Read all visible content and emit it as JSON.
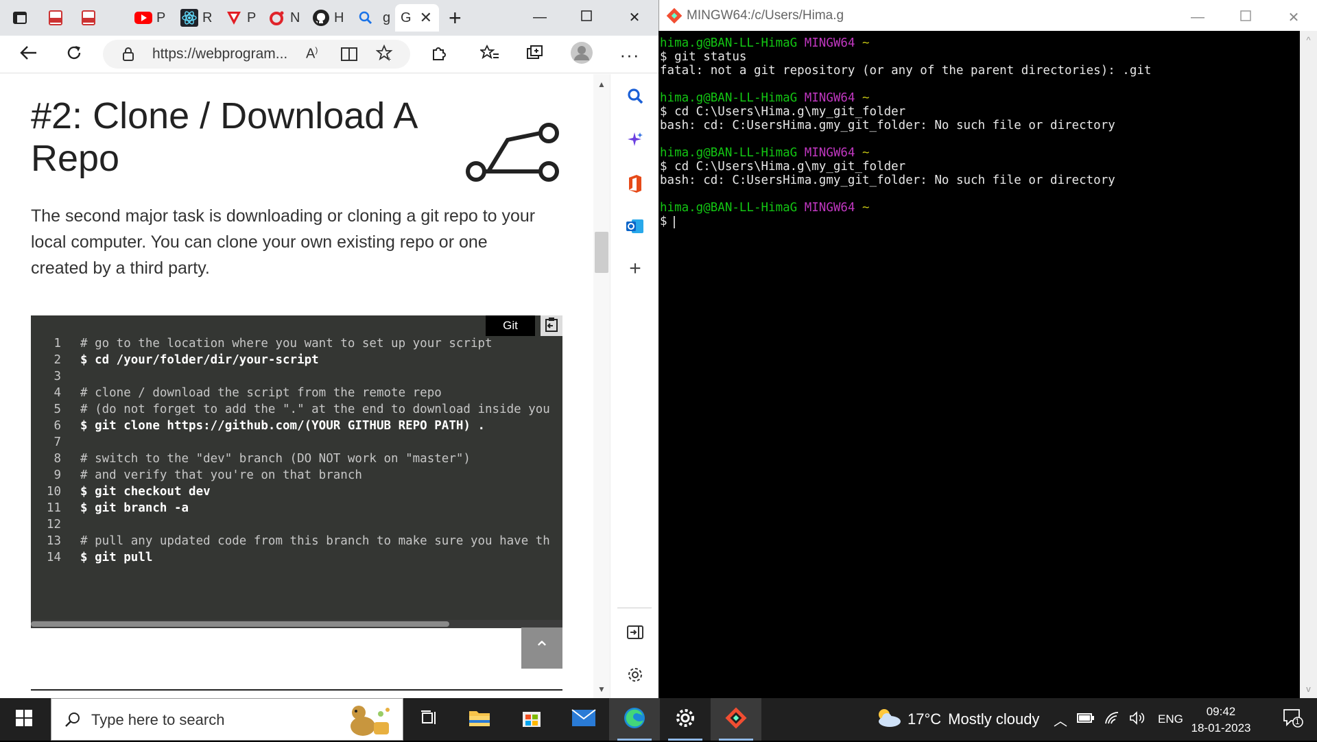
{
  "browser": {
    "tabs": [
      {
        "icon": "edge-tab-actions-icon",
        "label": ""
      },
      {
        "icon": "pdf-icon",
        "label": ""
      },
      {
        "icon": "pdf-icon",
        "label": ""
      },
      {
        "icon": "youtube-icon",
        "label": "P"
      },
      {
        "icon": "react-icon",
        "label": "R"
      },
      {
        "icon": "vivaldi-icon",
        "label": "P"
      },
      {
        "icon": "opera-icon",
        "label": "N"
      },
      {
        "icon": "github-icon",
        "label": "H"
      },
      {
        "icon": "search-icon",
        "label": "g"
      },
      {
        "icon": "g-icon",
        "label": "G"
      }
    ],
    "url": "https://webprogram...",
    "page": {
      "title": "#2: Clone / Download A Repo",
      "intro": "The second major task is downloading or cloning a git repo to your local computer. You can clone your own existing repo or one created by a third party.",
      "code_lang": "Git",
      "code_lines": [
        {
          "n": "1",
          "text": "# go to the location where you want to set up your script",
          "kind": "comment"
        },
        {
          "n": "2",
          "text": "$ cd /your/folder/dir/your-script",
          "kind": "cmd"
        },
        {
          "n": "3",
          "text": "",
          "kind": "comment"
        },
        {
          "n": "4",
          "text": "# clone / download the script from the remote repo",
          "kind": "comment"
        },
        {
          "n": "5",
          "text": "# (do not forget to add the \".\" at the end to download inside you",
          "kind": "comment"
        },
        {
          "n": "6",
          "text": "$ git clone https://github.com/(YOUR GITHUB REPO PATH) .",
          "kind": "cmd"
        },
        {
          "n": "7",
          "text": "",
          "kind": "comment"
        },
        {
          "n": "8",
          "text": "# switch to the \"dev\" branch (DO NOT work on \"master\")",
          "kind": "comment"
        },
        {
          "n": "9",
          "text": "# and verify that you're on that branch",
          "kind": "comment"
        },
        {
          "n": "10",
          "text": "$ git checkout dev",
          "kind": "cmd"
        },
        {
          "n": "11",
          "text": "$ git branch -a",
          "kind": "cmd"
        },
        {
          "n": "12",
          "text": "",
          "kind": "comment"
        },
        {
          "n": "13",
          "text": "# pull any updated code from this branch to make sure you have th",
          "kind": "comment"
        },
        {
          "n": "14",
          "text": "$ git pull",
          "kind": "cmd"
        }
      ]
    }
  },
  "terminal": {
    "title": "MINGW64:/c/Users/Hima.g",
    "prompt_user": "hima.g@BAN-LL-HimaG",
    "prompt_env": "MINGW64",
    "prompt_dir": "~",
    "blocks": [
      {
        "cmd": "$ git status",
        "out": "fatal: not a git repository (or any of the parent directories): .git"
      },
      {
        "cmd": "$ cd C:\\Users\\Hima.g\\my_git_folder",
        "out": "bash: cd: C:UsersHima.gmy_git_folder: No such file or directory"
      },
      {
        "cmd": "$ cd C:\\Users\\Hima.g\\my_git_folder",
        "out": "bash: cd: C:UsersHima.gmy_git_folder: No such file or directory"
      },
      {
        "cmd": "$ ",
        "out": ""
      }
    ]
  },
  "taskbar": {
    "search_placeholder": "Type here to search",
    "weather_temp": "17°C",
    "weather_desc": "Mostly cloudy",
    "lang": "ENG",
    "time": "09:42",
    "date": "18-01-2023",
    "notifications": "1"
  },
  "colors": {
    "prompt_green": "#13c613",
    "prompt_magenta": "#c037c0",
    "prompt_yellow": "#c6c613",
    "code_bg": "#343633"
  }
}
